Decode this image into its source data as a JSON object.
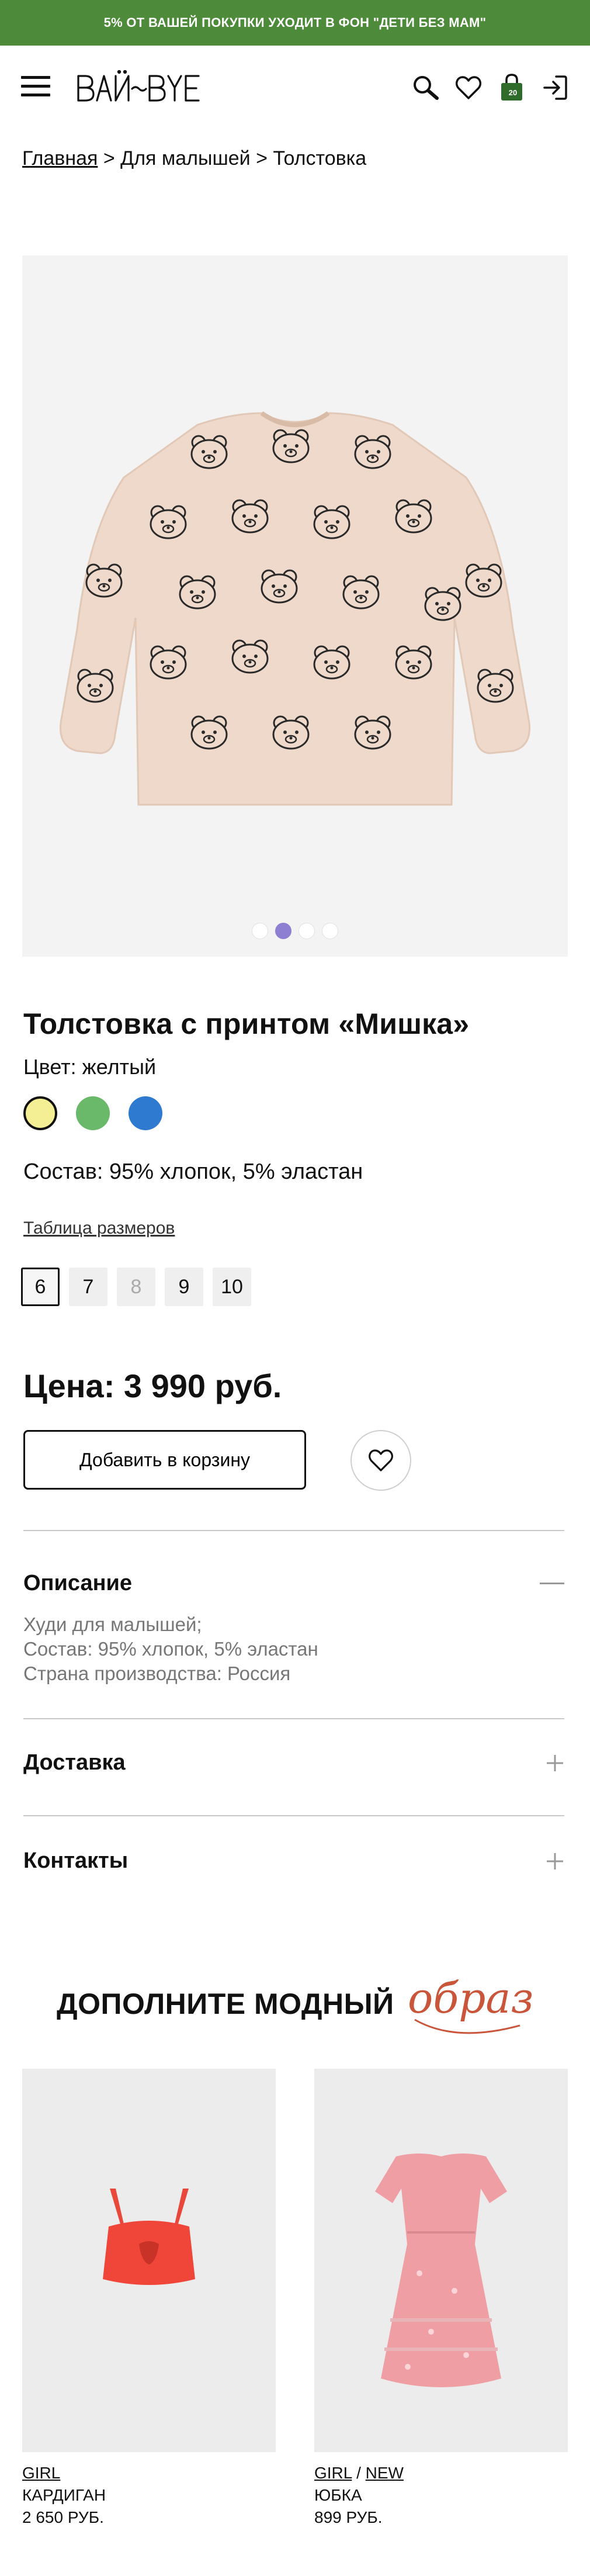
{
  "promo": "5% ОТ ВАШЕЙ ПОКУПКИ УХОДИТ В ФОН \"ДЕТИ БЕЗ МАМ\"",
  "header": {
    "logo": "BAЙ-BYE",
    "cart_count": "20"
  },
  "breadcrumb": {
    "home": "Главная",
    "sep1": " > ",
    "category": "Для малышей",
    "sep2": " > ",
    "current": "Толстовка"
  },
  "gallery": {
    "dots": 4,
    "active_dot": 2
  },
  "product": {
    "title": "Толстовка с принтом «Мишка»",
    "color_label": "Цвет: желтый",
    "colors": [
      "#f4ef94",
      "#6ab86a",
      "#2e7ad0"
    ],
    "composition": "Состав: 95% хлопок, 5% эластан",
    "size_table_link": "Таблица размеров",
    "sizes": [
      "6",
      "7",
      "8",
      "9",
      "10"
    ],
    "selected_size": "6",
    "disabled_size": "8",
    "price": "Цена: 3 990 руб.",
    "add_to_cart": "Добавить в корзину"
  },
  "accordion": {
    "description": {
      "title": "Описание",
      "lines": [
        "Худи для малышей;",
        "Состав: 95% хлопок, 5% эластан",
        "Страна производства: Россия"
      ]
    },
    "delivery": {
      "title": "Доставка"
    },
    "contacts": {
      "title": "Контакты"
    }
  },
  "complement": {
    "title": "ДОПОЛНИТЕ МОДНЫЙ",
    "script": "образ"
  },
  "cards": [
    {
      "tag1": "GIRL",
      "tag2": "",
      "name": "КАРДИГАН",
      "price": "2 650 РУБ."
    },
    {
      "tag1": "GIRL",
      "tag2": "NEW",
      "name": "ЮБКА",
      "price": "899 РУБ."
    }
  ],
  "colors": {
    "promo_bg": "#4d8a3a",
    "accent_dot": "#8f7fd3",
    "script_red": "#c9553a"
  }
}
